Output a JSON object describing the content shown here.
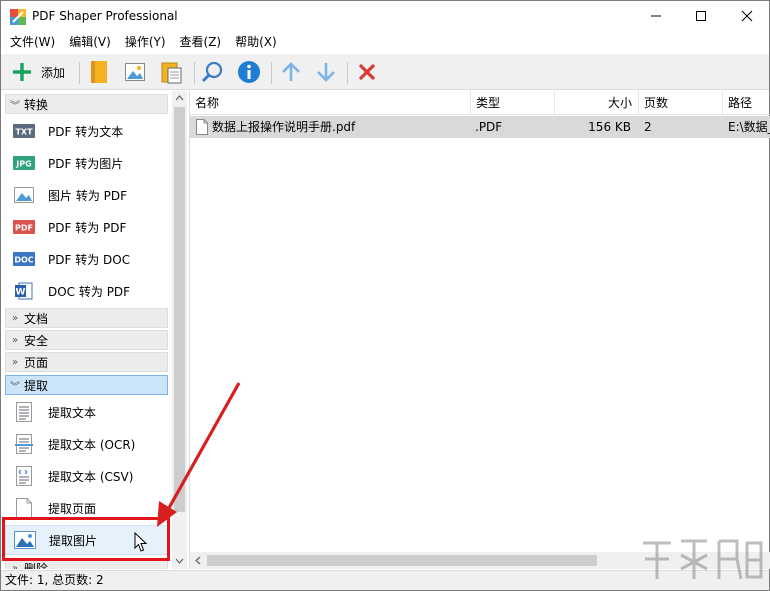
{
  "window": {
    "title": "PDF Shaper Professional"
  },
  "menu": [
    "文件(W)",
    "编辑(V)",
    "操作(Y)",
    "查看(Z)",
    "帮助(X)"
  ],
  "toolbar": {
    "add_label": "添加",
    "icons": [
      "plus-icon",
      "bookmark-icon",
      "image-icon",
      "paste-icon",
      "search-icon",
      "info-icon",
      "arrow-up-icon",
      "arrow-down-icon",
      "delete-icon"
    ],
    "colors": {
      "add": "#1aa260",
      "info": "#1e7ed4",
      "arrows": "#7db3e8",
      "delete": "#d83a34",
      "bookmark": "#f4b223"
    }
  },
  "sidebar": {
    "sections": [
      {
        "label": "转换",
        "expanded": true
      },
      {
        "label": "文档",
        "expanded": false
      },
      {
        "label": "安全",
        "expanded": false
      },
      {
        "label": "页面",
        "expanded": false
      },
      {
        "label": "提取",
        "expanded": true,
        "active": true
      },
      {
        "label": "删除",
        "expanded": false
      }
    ],
    "convert_items": [
      {
        "label": "PDF 转为文本",
        "icon": "txt-icon",
        "badge": "TXT"
      },
      {
        "label": "PDF 转为图片",
        "icon": "jpg-icon",
        "badge": "JPG"
      },
      {
        "label": "图片 转为 PDF",
        "icon": "image-icon",
        "badge": ""
      },
      {
        "label": "PDF 转为 PDF",
        "icon": "pdf-icon",
        "badge": "PDF"
      },
      {
        "label": "PDF 转为 DOC",
        "icon": "doc-icon",
        "badge": "DOC"
      },
      {
        "label": "DOC 转为 PDF",
        "icon": "word-icon",
        "badge": "W"
      }
    ],
    "extract_items": [
      {
        "label": "提取文本",
        "icon": "text-lines-icon"
      },
      {
        "label": "提取文本 (OCR)",
        "icon": "ocr-icon"
      },
      {
        "label": "提取文本 (CSV)",
        "icon": "csv-icon"
      },
      {
        "label": "提取页面",
        "icon": "page-icon"
      },
      {
        "label": "提取图片",
        "icon": "picture-icon",
        "selected": true
      }
    ]
  },
  "table": {
    "columns": [
      "名称",
      "类型",
      "大小",
      "页数",
      "路径"
    ],
    "rows": [
      {
        "name": "数据上报操作说明手册.pdf",
        "type": ".PDF",
        "size": "156 KB",
        "pages": "2",
        "path": "E:\\数据_"
      }
    ]
  },
  "status": {
    "text": "文件: 1, 总页数: 2"
  },
  "colors": {
    "highlight": "#e4131b",
    "arrow": "#d62020",
    "active_section": "#cce4f7"
  }
}
